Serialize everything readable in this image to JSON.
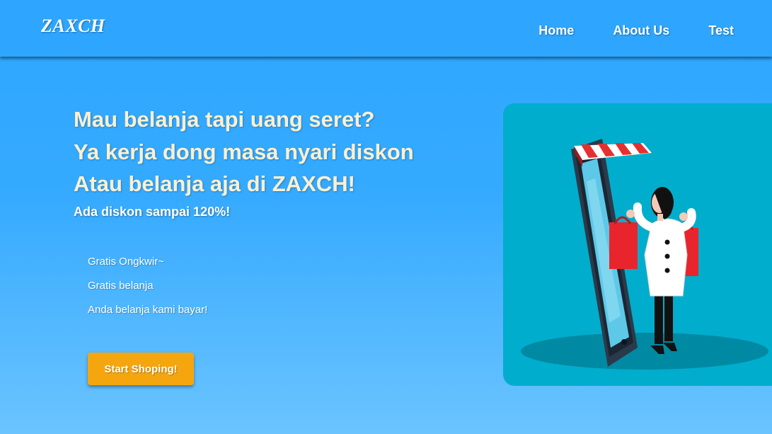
{
  "navbar": {
    "logo": "ZAXCH",
    "links": [
      {
        "label": "Home"
      },
      {
        "label": "About Us"
      },
      {
        "label": "Test"
      }
    ]
  },
  "hero": {
    "headline_lines": [
      "Mau belanja tapi uang seret?",
      "Ya kerja dong masa nyari diskon",
      "Atau belanja aja di ZAXCH!"
    ],
    "subheadline": "Ada diskon sampai 120%!",
    "features": [
      "Gratis Ongkwir~",
      "Gratis belanja",
      "Anda belanja kami bayar!"
    ],
    "cta_label": "Start Shoping!"
  },
  "colors": {
    "background": "#2ea7ff",
    "navbar": "#2ea6ff",
    "headline": "#fdf0d0",
    "cta": "#f5a60f",
    "illustration_bg": "#00adcc"
  }
}
